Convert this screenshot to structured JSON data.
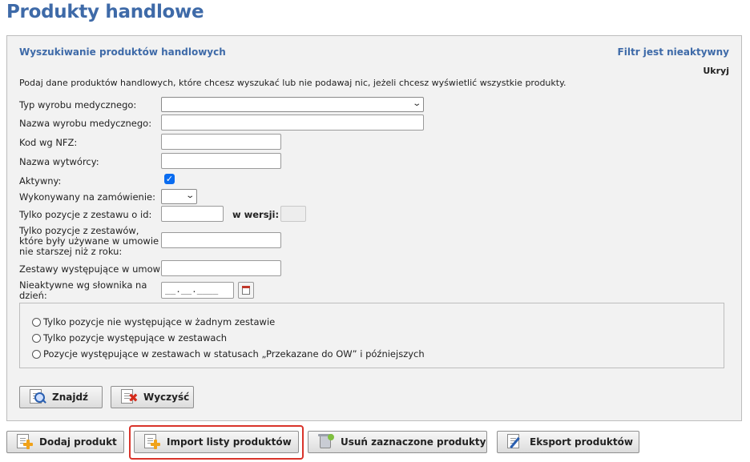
{
  "page": {
    "title": "Produkty handlowe"
  },
  "search_panel": {
    "title": "Wyszukiwanie produktów handlowych",
    "filter_status": "Filtr jest nieaktywny",
    "hide_label": "Ukryj",
    "intro": "Podaj dane produktów handlowych, które chcesz wyszukać lub nie podawaj nic, jeżeli chcesz wyświetlić wszystkie produkty.",
    "fields": {
      "typ_wyrobu": {
        "label": "Typ wyrobu medycznego:",
        "value": ""
      },
      "nazwa_wyrobu": {
        "label": "Nazwa wyrobu medycznego:",
        "value": ""
      },
      "kod_nfz": {
        "label": "Kod wg NFZ:",
        "value": ""
      },
      "nazwa_wytworcy": {
        "label": "Nazwa wytwórcy:",
        "value": ""
      },
      "aktywny": {
        "label": "Aktywny:",
        "checked": true
      },
      "wykonywany": {
        "label": "Wykonywany na zamówienie:",
        "value": ""
      },
      "zestaw_id": {
        "label": "Tylko pozycje z zestawu o id:",
        "value": "",
        "version_label": "w wersji:",
        "version_value": ""
      },
      "zestawy_umowa": {
        "label": "Tylko pozycje z zestawów, które były używane w umowie nie starszej niż z roku:",
        "value": ""
      },
      "zestawy_wystepujace": {
        "label": "Zestawy występujące w umowie:",
        "value": ""
      },
      "nieaktywne": {
        "label": "Nieaktywne wg słownika na dzień:",
        "placeholder": "__.__.____"
      }
    },
    "radio_options": [
      "Tylko pozycje nie występujące w żadnym zestawie",
      "Tylko pozycje występujące w zestawach",
      "Pozycje występujące w zestawach w statusach „Przekazane do OW” i późniejszych"
    ],
    "buttons": {
      "search": "Znajdź",
      "clear": "Wyczyść"
    }
  },
  "toolbar": {
    "add": "Dodaj produkt",
    "import": "Import listy produktów",
    "delete": "Usuń zaznaczone produkty",
    "export": "Eksport produktów"
  },
  "colors": {
    "title": "#3e6aa8",
    "highlight": "#d9342b",
    "checkbox": "#0a6cf0"
  }
}
